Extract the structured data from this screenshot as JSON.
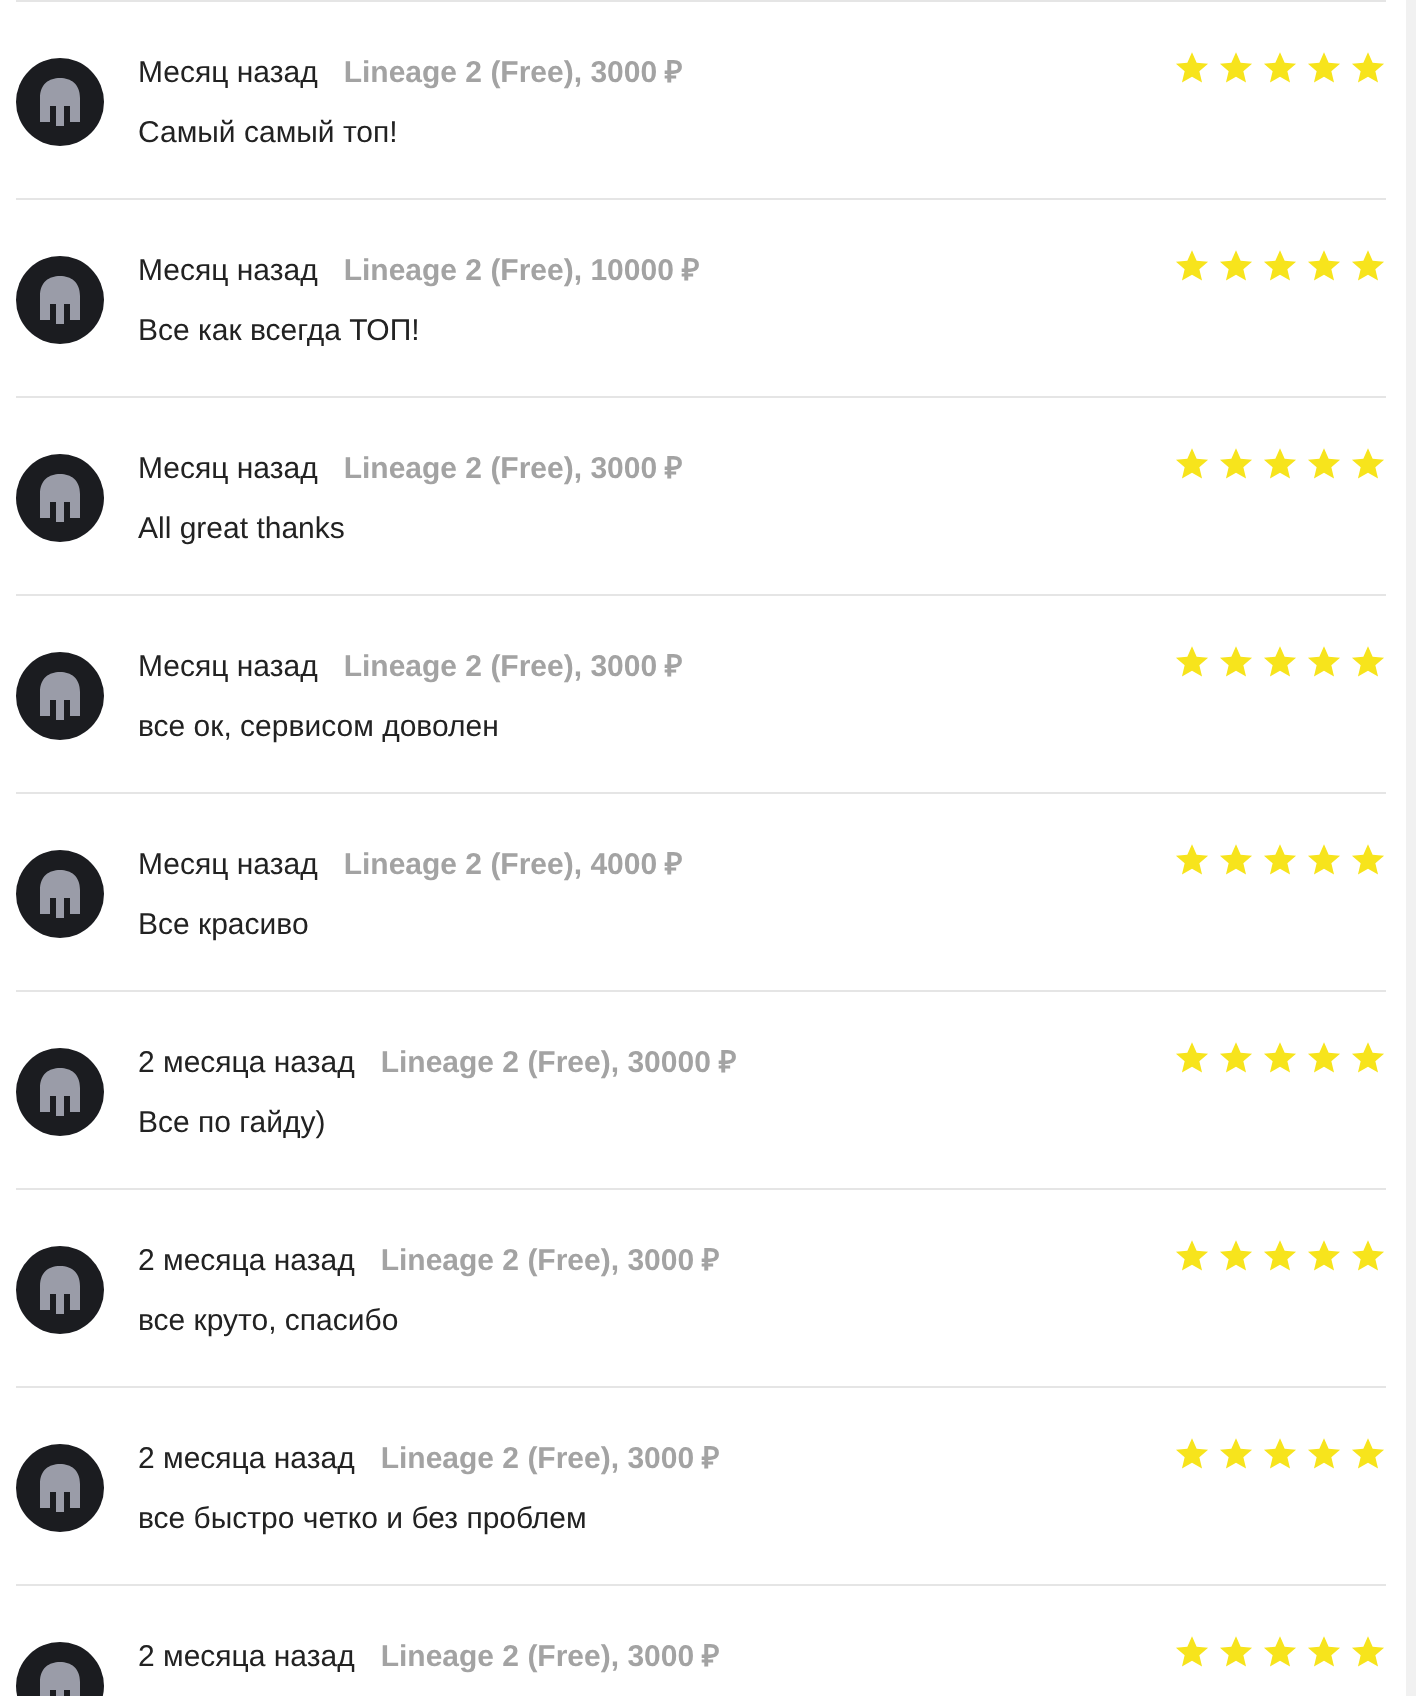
{
  "reviews": [
    {
      "time": "Месяц назад",
      "product": "Lineage 2 (Free), 3000 ₽",
      "text": "Самый самый топ!",
      "stars": 5
    },
    {
      "time": "Месяц назад",
      "product": "Lineage 2 (Free), 10000 ₽",
      "text": "Все как всегда ТОП!",
      "stars": 5
    },
    {
      "time": "Месяц назад",
      "product": "Lineage 2 (Free), 3000 ₽",
      "text": "All great thanks",
      "stars": 5
    },
    {
      "time": "Месяц назад",
      "product": "Lineage 2 (Free), 3000 ₽",
      "text": "все ок, сервисом доволен",
      "stars": 5
    },
    {
      "time": "Месяц назад",
      "product": "Lineage 2 (Free), 4000 ₽",
      "text": "Все красиво",
      "stars": 5
    },
    {
      "time": "2 месяца назад",
      "product": "Lineage 2 (Free), 30000 ₽",
      "text": "Все по гайду)",
      "stars": 5
    },
    {
      "time": "2 месяца назад",
      "product": "Lineage 2 (Free), 3000 ₽",
      "text": "все круто, спасибо",
      "stars": 5
    },
    {
      "time": "2 месяца назад",
      "product": "Lineage 2 (Free), 3000 ₽",
      "text": "все быстро четко и без проблем",
      "stars": 5
    },
    {
      "time": "2 месяца назад",
      "product": "Lineage 2 (Free), 3000 ₽",
      "stars": 5
    }
  ]
}
